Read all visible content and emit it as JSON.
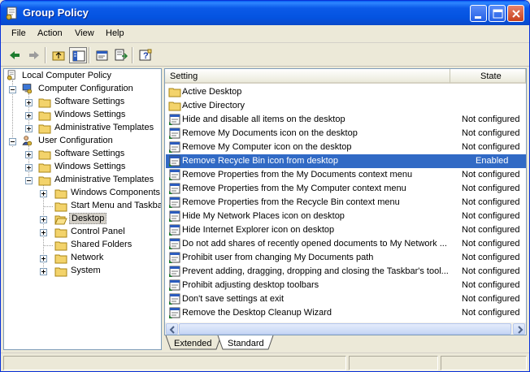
{
  "window": {
    "title": "Group Policy"
  },
  "menubar": {
    "items": [
      "File",
      "Action",
      "View",
      "Help"
    ]
  },
  "tree": {
    "items": [
      {
        "label": "Local Computer Policy",
        "icon": "policy-icon",
        "level": 0
      },
      {
        "label": "Computer Configuration",
        "icon": "computer-icon",
        "level": 1,
        "expander": "minus"
      },
      {
        "label": "Software Settings",
        "icon": "folder-icon",
        "level": 2,
        "expander": "plus"
      },
      {
        "label": "Windows Settings",
        "icon": "folder-icon",
        "level": 2,
        "expander": "plus"
      },
      {
        "label": "Administrative Templates",
        "icon": "folder-icon",
        "level": 2,
        "expander": "plus"
      },
      {
        "label": "User Configuration",
        "icon": "user-icon",
        "level": 1,
        "expander": "minus"
      },
      {
        "label": "Software Settings",
        "icon": "folder-icon",
        "level": 2,
        "expander": "plus"
      },
      {
        "label": "Windows Settings",
        "icon": "folder-icon",
        "level": 2,
        "expander": "plus"
      },
      {
        "label": "Administrative Templates",
        "icon": "folder-icon",
        "level": 2,
        "expander": "minus"
      },
      {
        "label": "Windows Components",
        "icon": "folder-icon",
        "level": 3,
        "expander": "plus"
      },
      {
        "label": "Start Menu and Taskbar",
        "icon": "folder-icon",
        "level": 3
      },
      {
        "label": "Desktop",
        "icon": "folder-open-icon",
        "level": 3,
        "expander": "plus",
        "selected": true
      },
      {
        "label": "Control Panel",
        "icon": "folder-icon",
        "level": 3,
        "expander": "plus"
      },
      {
        "label": "Shared Folders",
        "icon": "folder-icon",
        "level": 3
      },
      {
        "label": "Network",
        "icon": "folder-icon",
        "level": 3,
        "expander": "plus"
      },
      {
        "label": "System",
        "icon": "folder-icon",
        "level": 3,
        "expander": "plus"
      }
    ]
  },
  "list": {
    "columns": {
      "setting": "Setting",
      "state": "State"
    },
    "rows": [
      {
        "name": "Active Desktop",
        "state": "",
        "icon": "folder-icon"
      },
      {
        "name": "Active Directory",
        "state": "",
        "icon": "folder-icon"
      },
      {
        "name": "Hide and disable all items on the desktop",
        "state": "Not configured",
        "icon": "setting-icon"
      },
      {
        "name": "Remove My Documents icon on the desktop",
        "state": "Not configured",
        "icon": "setting-icon"
      },
      {
        "name": "Remove My Computer icon on the desktop",
        "state": "Not configured",
        "icon": "setting-icon"
      },
      {
        "name": "Remove Recycle Bin icon from desktop",
        "state": "Enabled",
        "icon": "setting-icon",
        "selected": true
      },
      {
        "name": "Remove Properties from the My Documents context menu",
        "state": "Not configured",
        "icon": "setting-icon"
      },
      {
        "name": "Remove Properties from the My Computer context menu",
        "state": "Not configured",
        "icon": "setting-icon"
      },
      {
        "name": "Remove Properties from the Recycle Bin context menu",
        "state": "Not configured",
        "icon": "setting-icon"
      },
      {
        "name": "Hide My Network Places icon on desktop",
        "state": "Not configured",
        "icon": "setting-icon"
      },
      {
        "name": "Hide Internet Explorer icon on desktop",
        "state": "Not configured",
        "icon": "setting-icon"
      },
      {
        "name": "Do not add shares of recently opened documents to My Network ...",
        "state": "Not configured",
        "icon": "setting-icon"
      },
      {
        "name": "Prohibit user from changing My Documents path",
        "state": "Not configured",
        "icon": "setting-icon"
      },
      {
        "name": "Prevent adding, dragging, dropping and closing the Taskbar's tool...",
        "state": "Not configured",
        "icon": "setting-icon"
      },
      {
        "name": "Prohibit adjusting desktop toolbars",
        "state": "Not configured",
        "icon": "setting-icon"
      },
      {
        "name": "Don't save settings at exit",
        "state": "Not configured",
        "icon": "setting-icon"
      },
      {
        "name": "Remove the Desktop Cleanup Wizard",
        "state": "Not configured",
        "icon": "setting-icon"
      }
    ]
  },
  "tabs": {
    "extended": "Extended",
    "standard": "Standard",
    "active": "Standard"
  },
  "colors": {
    "selection": "#316ac5",
    "titlebar": "#0453e0",
    "close": "#c8411d"
  }
}
